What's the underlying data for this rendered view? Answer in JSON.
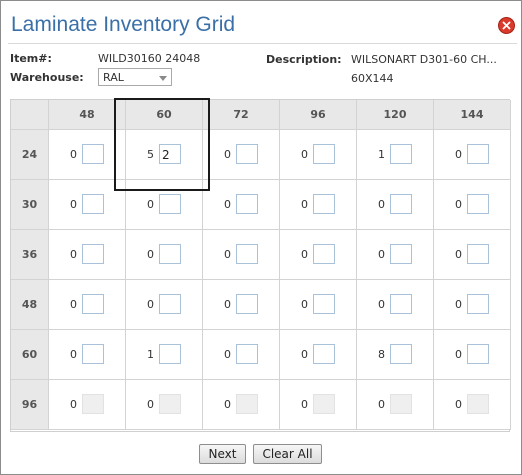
{
  "dialog": {
    "title": "Laminate Inventory Grid",
    "close_icon": "close-icon"
  },
  "header": {
    "item_label": "Item#:",
    "item_value": "WILD30160 24048",
    "warehouse_label": "Warehouse:",
    "warehouse_value": "RAL",
    "description_label": "Description:",
    "description_line1": "WILSONART D301-60 CH...",
    "description_line2": "60X144"
  },
  "grid": {
    "columns": [
      "48",
      "60",
      "72",
      "96",
      "120",
      "144"
    ],
    "rows": [
      {
        "label": "24",
        "qty": [
          "0",
          "5",
          "0",
          "0",
          "1",
          "0"
        ],
        "inputs": [
          "",
          "2",
          "",
          "",
          "",
          ""
        ],
        "disabled": false
      },
      {
        "label": "30",
        "qty": [
          "0",
          "0",
          "0",
          "0",
          "0",
          "0"
        ],
        "inputs": [
          "",
          "",
          "",
          "",
          "",
          ""
        ],
        "disabled": false
      },
      {
        "label": "36",
        "qty": [
          "0",
          "0",
          "0",
          "0",
          "0",
          "0"
        ],
        "inputs": [
          "",
          "",
          "",
          "",
          "",
          ""
        ],
        "disabled": false
      },
      {
        "label": "48",
        "qty": [
          "0",
          "0",
          "0",
          "0",
          "0",
          "0"
        ],
        "inputs": [
          "",
          "",
          "",
          "",
          "",
          ""
        ],
        "disabled": false
      },
      {
        "label": "60",
        "qty": [
          "0",
          "1",
          "0",
          "0",
          "8",
          "0"
        ],
        "inputs": [
          "",
          "",
          "",
          "",
          "",
          ""
        ],
        "disabled": false
      },
      {
        "label": "96",
        "qty": [
          "0",
          "0",
          "0",
          "0",
          "0",
          "0"
        ],
        "inputs": [
          "",
          "",
          "",
          "",
          "",
          ""
        ],
        "disabled": true
      }
    ]
  },
  "buttons": {
    "next_label": "Next",
    "clear_label": "Clear All"
  },
  "colors": {
    "title": "#3a6fa8",
    "close": "#d93a2b",
    "header_bg": "#e8e8e8",
    "highlight": "#1a1a1a"
  }
}
